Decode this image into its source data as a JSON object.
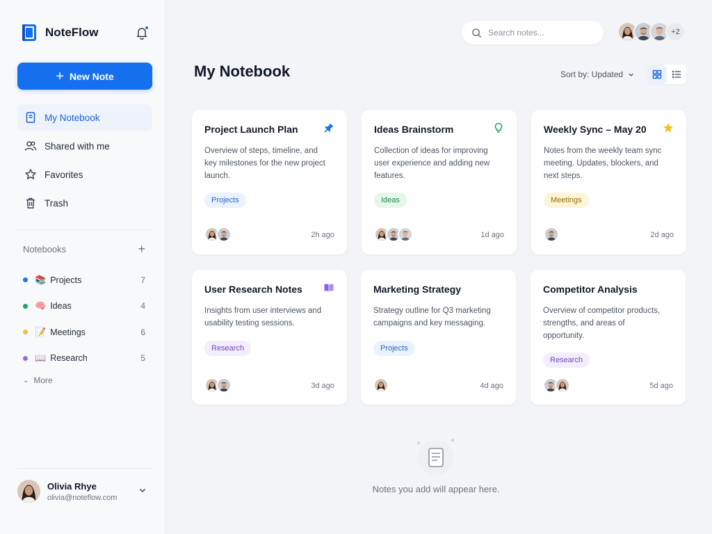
{
  "app": {
    "name": "NoteFlow"
  },
  "sidebar": {
    "new_note_label": "New Note",
    "nav": [
      {
        "label": "My Notebook",
        "icon": "notebook-icon"
      },
      {
        "label": "Shared with me",
        "icon": "users-icon"
      },
      {
        "label": "Favorites",
        "icon": "star-icon"
      },
      {
        "label": "Trash",
        "icon": "trash-icon"
      }
    ],
    "notebooks_header": "Notebooks",
    "notebooks": [
      {
        "name": "Projects",
        "emoji": "📚",
        "count": "7",
        "color": "#2f6fe4"
      },
      {
        "name": "Ideas",
        "emoji": "🧠",
        "count": "4",
        "color": "#22a55b"
      },
      {
        "name": "Meetings",
        "emoji": "📝",
        "count": "6",
        "color": "#f2c12e"
      },
      {
        "name": "Research",
        "emoji": "📖",
        "count": "5",
        "color": "#9c6ade"
      }
    ],
    "more_label": "More",
    "user": {
      "name": "Olivia Rhye",
      "email": "olivia@noteflow.com"
    }
  },
  "topbar": {
    "search_placeholder": "Search notes...",
    "team_extra": "+2"
  },
  "main": {
    "title": "My Notebook",
    "sort_label": "Sort by: Updated",
    "cards": [
      {
        "title": "Project Launch Plan",
        "icon": "pin-icon",
        "desc": "Overview of steps, timeline, and key milestones for the new project launch.",
        "tag": "Projects",
        "time": "2h ago"
      },
      {
        "title": "Ideas Brainstorm",
        "icon": "lightbulb-icon",
        "desc": "Collection of ideas for improving user experience and adding new features.",
        "tag": "Ideas",
        "time": "1d ago"
      },
      {
        "title": "Weekly Sync – May 20",
        "icon": "star-icon",
        "desc": "Notes from the weekly team sync meeting. Updates, blockers, and next steps.",
        "tag": "Meetings",
        "time": "2d ago"
      },
      {
        "title": "User Research Notes",
        "icon": "book-icon",
        "desc": "Insights from user interviews and usability testing sessions.",
        "tag": "Research",
        "time": "3d ago"
      },
      {
        "title": "Marketing Strategy",
        "icon": "",
        "desc": "Strategy outline for Q3 marketing campaigns and key messaging.",
        "tag": "Projects",
        "time": "4d ago"
      },
      {
        "title": "Competitor Analysis",
        "icon": "",
        "desc": "Overview of competitor products, strengths, and areas of opportunity.",
        "tag": "Research",
        "time": "5d ago"
      }
    ],
    "empty_text": "Notes you add will appear here."
  },
  "colors": {
    "accent": "#1570ef",
    "background": "#f3f4f7"
  }
}
